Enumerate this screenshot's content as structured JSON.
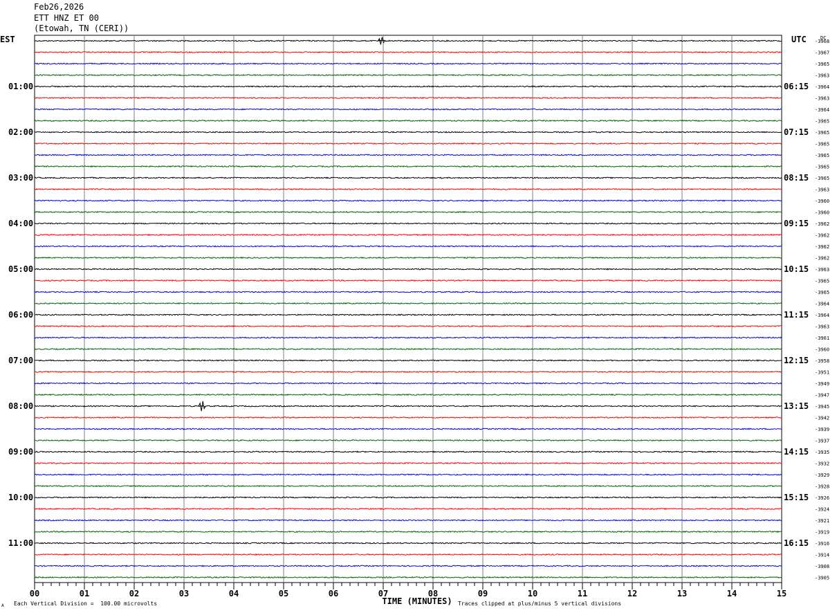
{
  "header": {
    "date": "Feb26,2026",
    "station": "ETT HNZ ET 00",
    "location": "(Etowah, TN (CERI))"
  },
  "colors": {
    "trace_cycle": [
      "#000000",
      "#ff0000",
      "#0000ff",
      "#006400"
    ],
    "grid": "#808080"
  },
  "chart_data": {
    "type": "line",
    "left_timezone": "EST",
    "right_timezone": "UTC",
    "dc_label": "DC",
    "xlabel": "TIME (MINUTES)",
    "xlim": [
      0,
      15
    ],
    "x_ticks": [
      "00",
      "01",
      "02",
      "03",
      "04",
      "05",
      "06",
      "07",
      "08",
      "09",
      "10",
      "11",
      "12",
      "13",
      "14",
      "15"
    ],
    "rows": 48,
    "minutes_per_row": 15,
    "left_hour_labels": [
      "01:00",
      "02:00",
      "03:00",
      "04:00",
      "05:00",
      "06:00",
      "07:00",
      "08:00",
      "09:00",
      "10:00",
      "11:00"
    ],
    "right_hour_labels": [
      "06:15",
      "07:15",
      "08:15",
      "09:15",
      "10:15",
      "11:15",
      "12:15",
      "13:15",
      "14:15",
      "15:15",
      "16:15"
    ],
    "dc_offsets": [
      -3968,
      -3967,
      -3965,
      -3963,
      -3964,
      -3963,
      -3964,
      -3965,
      -3965,
      -3965,
      -3965,
      -3965,
      -3965,
      -3963,
      -3960,
      -3960,
      -3962,
      -3962,
      -3962,
      -3962,
      -3963,
      -3965,
      -3965,
      -3964,
      -3964,
      -3963,
      -3961,
      -3960,
      -3958,
      -3951,
      -3949,
      -3947,
      -3945,
      -3942,
      -3939,
      -3937,
      -3935,
      -3932,
      -3929,
      -3928,
      -3926,
      -3924,
      -3921,
      -3919,
      -3916,
      -3914,
      -3908,
      -3905
    ],
    "events": [
      {
        "row": 0,
        "minute": 6.95,
        "amplitude": 0.45
      },
      {
        "row": 32,
        "minute": 3.35,
        "amplitude": 0.6
      }
    ]
  },
  "footer": {
    "scale_note": "Each Vertical Division =  100.00 microvolts",
    "clip_note": "Traces clipped at plus/minus 5 vertical divisions",
    "corner_mark": "A"
  }
}
